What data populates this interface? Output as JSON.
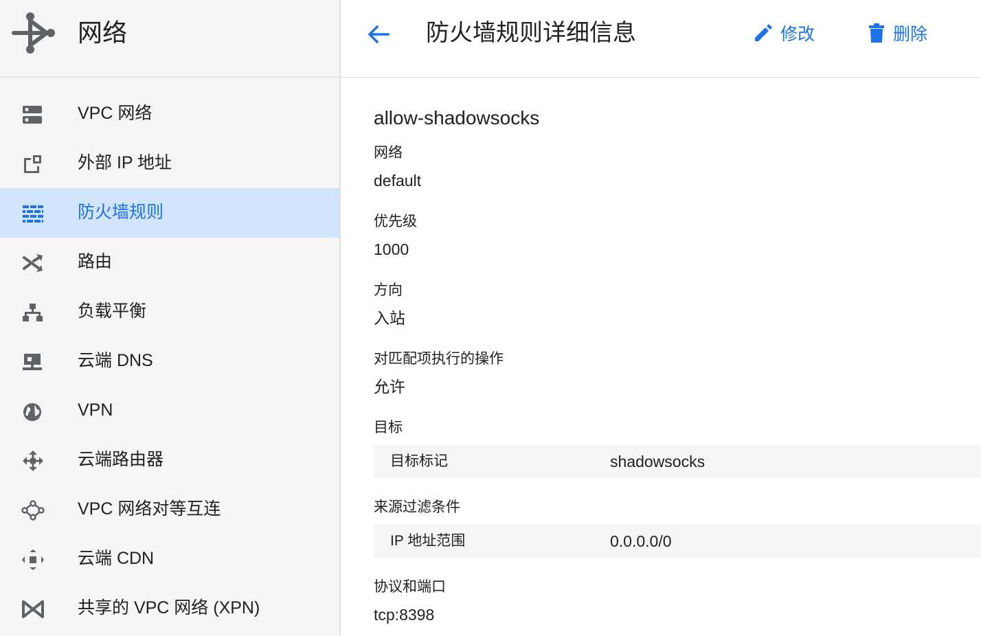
{
  "sidebar": {
    "title": "网络",
    "items": [
      {
        "label": "VPC 网络",
        "icon": "vpc-network-icon"
      },
      {
        "label": "外部 IP 地址",
        "icon": "external-ip-icon"
      },
      {
        "label": "防火墙规则",
        "icon": "firewall-icon",
        "active": true
      },
      {
        "label": "路由",
        "icon": "routes-icon"
      },
      {
        "label": "负载平衡",
        "icon": "load-balancing-icon"
      },
      {
        "label": "云端 DNS",
        "icon": "cloud-dns-icon"
      },
      {
        "label": "VPN",
        "icon": "vpn-icon"
      },
      {
        "label": "云端路由器",
        "icon": "cloud-router-icon"
      },
      {
        "label": "VPC 网络对等互连",
        "icon": "vpc-peering-icon"
      },
      {
        "label": "云端 CDN",
        "icon": "cloud-cdn-icon"
      },
      {
        "label": "共享的 VPC 网络 (XPN)",
        "icon": "shared-vpc-icon"
      }
    ]
  },
  "header": {
    "title": "防火墙规则详细信息",
    "edit_label": "修改",
    "delete_label": "删除"
  },
  "rule": {
    "name": "allow-shadowsocks",
    "network_label": "网络",
    "network_value": "default",
    "priority_label": "优先级",
    "priority_value": "1000",
    "direction_label": "方向",
    "direction_value": "入站",
    "action_label": "对匹配项执行的操作",
    "action_value": "允许",
    "targets_label": "目标",
    "targets_key": "目标标记",
    "targets_value": "shadowsocks",
    "source_label": "来源过滤条件",
    "source_key": "IP 地址范围",
    "source_value": "0.0.0.0/0",
    "protocols_label": "协议和端口",
    "protocols_value": "tcp:8398"
  },
  "colors": {
    "accent": "#1a73e8",
    "active_bg": "#d2e3fc",
    "sidebar_bg": "#f5f5f5",
    "icon_gray": "#5f6368"
  }
}
